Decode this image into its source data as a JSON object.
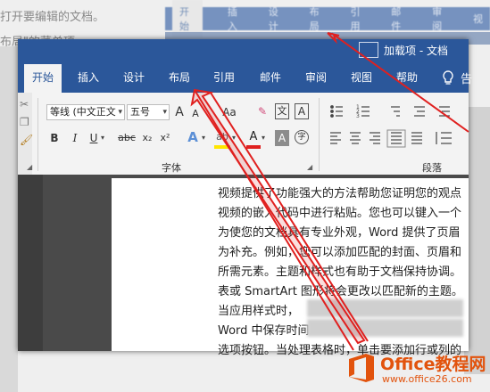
{
  "background": {
    "lines": [
      "打开要编辑的文档。",
      "布局\"的菜单项。"
    ],
    "tabs": [
      "开始",
      "插入",
      "设计",
      "布局",
      "引用",
      "邮件",
      "审阅",
      "视"
    ]
  },
  "title_bar": {
    "text": "加载项 - 文档"
  },
  "ribbon": {
    "tabs": [
      "开始",
      "插入",
      "设计",
      "布局",
      "引用",
      "邮件",
      "审阅",
      "视图",
      "帮助"
    ],
    "active_tab": "开始",
    "tell_me_glyph": "告",
    "font": {
      "font_name": "等线 (中文正文",
      "font_size": "五号",
      "grow": "A",
      "shrink": "A",
      "change_case": "Aa",
      "wen": "文",
      "A_box": "A",
      "bold": "B",
      "italic": "I",
      "underline": "U",
      "strike": "abc",
      "subscript": "x₂",
      "superscript": "x²",
      "text_effect": "A",
      "highlight": "ab",
      "font_color": "A",
      "shading": "A",
      "enclose": "字",
      "group_label": "字体"
    },
    "paragraph": {
      "group_label": "段落"
    }
  },
  "document": {
    "lines": [
      "视频提供了功能强大的方法帮助您证明您的观点",
      "视频的嵌入代码中进行粘贴。您也可以键入一个",
      "为使您的文档具有专业外观，Word 提供了页眉",
      "为补充。例如，您可以添加匹配的封面、页眉和",
      "所需元素。主题和样式也有助于文档保持协调。",
      "表或 SmartArt 图形将会更改以匹配新的主题。",
      "当应用样式时，",
      "Word 中保存时间",
      "选项按钮。当处理表格时，单击要添加行或列的"
    ]
  },
  "logo": {
    "title": "Office教程网",
    "url": "www.office26.com"
  },
  "colors": {
    "word_blue": "#2b579a",
    "arrow_red": "#e0201f",
    "logo_orange": "#e2530d"
  }
}
